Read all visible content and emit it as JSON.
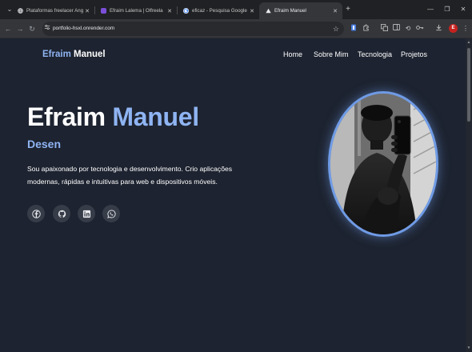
{
  "browser": {
    "tabs": [
      {
        "title": "Plataformas freelacer Angola",
        "favicon": "globe-icon",
        "active": false
      },
      {
        "title": "Efraim Lalema | Olfreela",
        "favicon": "workspace-icon",
        "active": false
      },
      {
        "title": "eficaz - Pesquisa Google",
        "favicon": "google-icon",
        "active": false
      },
      {
        "title": "Efraim Manuel",
        "favicon": "vercel-triangle-icon",
        "active": true
      }
    ],
    "url": "portfolio-hsxl.onrender.com",
    "profile_initial": "E"
  },
  "site": {
    "brand_first": "Efraim",
    "brand_last": "Manuel",
    "nav": [
      "Home",
      "Sobre Mim",
      "Tecnologia",
      "Projetos"
    ],
    "hero": {
      "first_name": "Efraim",
      "last_name": "Manuel",
      "role": "Desen",
      "bio": "Sou apaixonado por tecnologia e desenvolvimento. Crio aplicações modernas, rápidas e intuitivas para web e dispositivos móveis."
    },
    "social": [
      "facebook-icon",
      "github-icon",
      "linkedin-icon",
      "whatsapp-icon"
    ]
  },
  "colors": {
    "page_bg": "#1d2330",
    "accent": "#8fb4f3",
    "avatar_ring": "#6f9be6",
    "social_bg": "#363c48"
  }
}
